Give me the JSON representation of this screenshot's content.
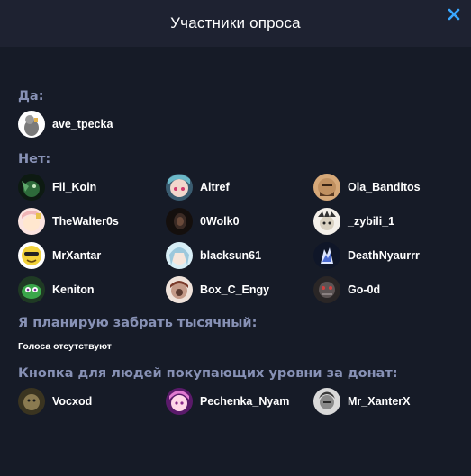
{
  "dialog": {
    "title": "Участники опроса",
    "close_icon": "close-icon",
    "accent": "#39a7ff"
  },
  "sections": [
    {
      "title": "Да:",
      "users": [
        {
          "name": "ave_tpecka",
          "avatar": "#8a8a8a"
        }
      ]
    },
    {
      "title": "Нет:",
      "users": [
        {
          "name": "Fil_Koin",
          "avatar": "#2d6a3a"
        },
        {
          "name": "Altref",
          "avatar": "#6bb8c8"
        },
        {
          "name": "Ola_Banditos",
          "avatar": "#c09060"
        },
        {
          "name": "TheWalter0s",
          "avatar": "#f0b6b6"
        },
        {
          "name": "0Wolk0",
          "avatar": "#3a2a24"
        },
        {
          "name": "_zybili_1",
          "avatar": "#d8d0c0"
        },
        {
          "name": "MrXantar",
          "avatar": "#f2d23a"
        },
        {
          "name": "blacksun61",
          "avatar": "#9cc8dc"
        },
        {
          "name": "DeathNyaurrr",
          "avatar": "#2b3a6a"
        },
        {
          "name": "Keniton",
          "avatar": "#3aa64a"
        },
        {
          "name": "Box_C_Engy",
          "avatar": "#c49a88"
        },
        {
          "name": "Go-0d",
          "avatar": "#5c5454"
        }
      ]
    },
    {
      "title": "Я планирую забрать тысячный:",
      "empty": "Голоса отсутствуют",
      "users": []
    },
    {
      "title": "Кнопка для людей покупающих уровни за донат:",
      "users": [
        {
          "name": "Vocxod",
          "avatar": "#8a7a50"
        },
        {
          "name": "Pechenka_Nyam",
          "avatar": "#e07ad0"
        },
        {
          "name": "Mr_XanterX",
          "avatar": "#8a8a8a"
        }
      ]
    }
  ]
}
